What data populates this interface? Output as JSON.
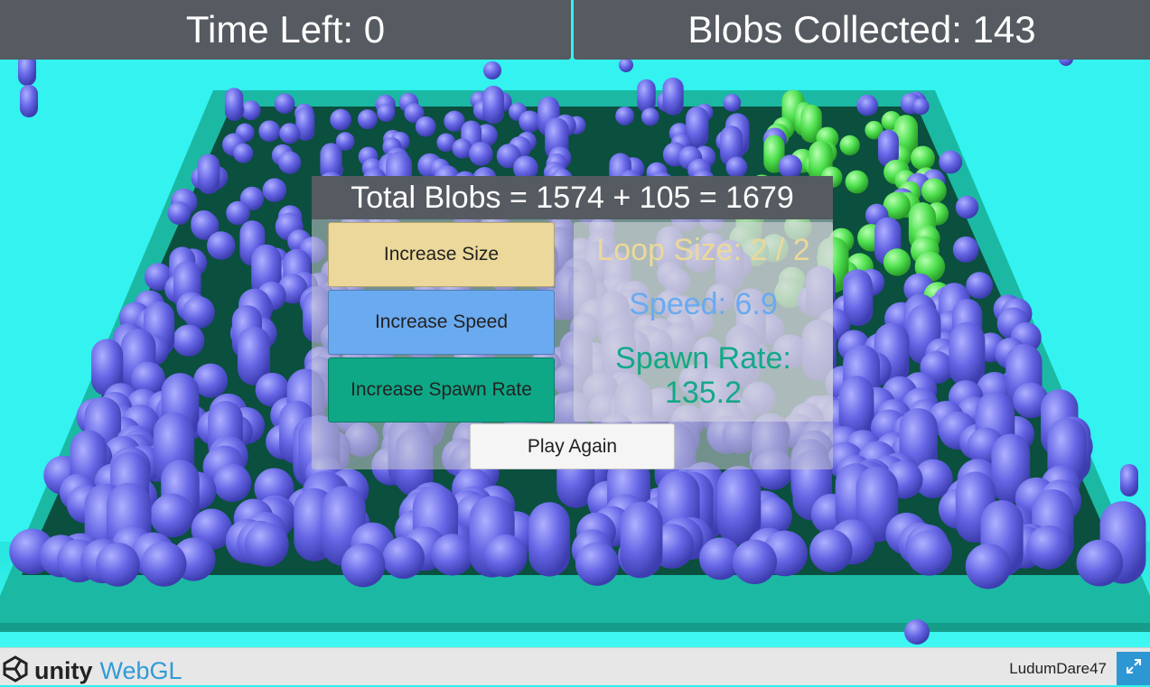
{
  "hud": {
    "time_left": "Time Left: 0",
    "blobs_collected": "Blobs Collected: 143"
  },
  "panel": {
    "title": "Total Blobs = 1574 + 105 = 1679",
    "buttons": {
      "increase_size": "Increase Size",
      "increase_speed": "Increase Speed",
      "increase_spawn_rate": "Increase Spawn Rate",
      "play_again": "Play Again"
    },
    "stats": {
      "loop_size": "Loop Size: 2 / 2",
      "speed": "Speed: 6.9",
      "spawn_rate_label": "Spawn Rate:",
      "spawn_rate_value": "135.2"
    }
  },
  "footer": {
    "unity_text": "unity",
    "webgl_text": "WebGL",
    "build_name": "LudumDare47",
    "icons": [
      "unity-logo-icon",
      "fullscreen-icon"
    ]
  },
  "colors": {
    "background": "#33f2ef",
    "arena_rim": "#1bb9a3",
    "arena_floor": "#0b4f3e",
    "blob_purple": "#6a6ae8",
    "blob_green": "#5ae25a",
    "hud_bg": "#555b60",
    "size_button": "#ecd89a",
    "speed_button": "#6aaaf0",
    "spawn_button": "#0ea887",
    "webgl_blue": "#2f9bd8"
  }
}
